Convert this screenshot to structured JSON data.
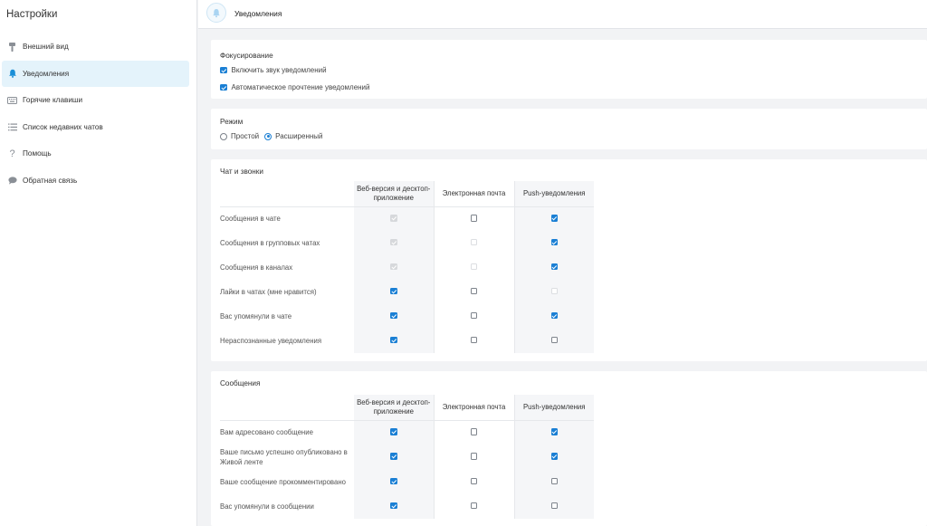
{
  "sidebar": {
    "title": "Настройки",
    "items": [
      {
        "label": "Внешний вид",
        "icon": "brush-icon",
        "active": false
      },
      {
        "label": "Уведомления",
        "icon": "bell-icon",
        "active": true
      },
      {
        "label": "Горячие клавиши",
        "icon": "keyboard-icon",
        "active": false
      },
      {
        "label": "Список недавних чатов",
        "icon": "list-icon",
        "active": false
      },
      {
        "label": "Помощь",
        "icon": "question-icon",
        "active": false
      },
      {
        "label": "Обратная связь",
        "icon": "chat-bubble-icon",
        "active": false
      }
    ]
  },
  "header": {
    "title": "Уведомления",
    "icon": "bell-icon"
  },
  "focus": {
    "title": "Фокусирование",
    "options": [
      {
        "label": "Включить звук уведомлений",
        "checked": true
      },
      {
        "label": "Автоматическое прочтение уведомлений",
        "checked": true
      }
    ]
  },
  "mode": {
    "title": "Режим",
    "options": [
      {
        "label": "Простой",
        "selected": false
      },
      {
        "label": "Расширенный",
        "selected": true
      }
    ]
  },
  "columns": {
    "web": "Веб-версия и десктоп-приложение",
    "email": "Электронная почта",
    "push": "Push-уведомления"
  },
  "chat": {
    "title": "Чат и звонки",
    "rows": [
      {
        "label": "Сообщения в чате",
        "web": "dis-on",
        "email": "off",
        "push": "on"
      },
      {
        "label": "Сообщения в групповых чатах",
        "web": "dis-on",
        "email": "dis-off",
        "push": "on"
      },
      {
        "label": "Сообщения в каналах",
        "web": "dis-on",
        "email": "dis-off",
        "push": "on"
      },
      {
        "label": "Лайки в чатах (мне нравится)",
        "web": "on",
        "email": "off",
        "push": "dis-off"
      },
      {
        "label": "Вас упомянули в чате",
        "web": "on",
        "email": "off",
        "push": "on"
      },
      {
        "label": "Нераспознанные уведомления",
        "web": "on",
        "email": "off",
        "push": "off"
      }
    ]
  },
  "messages": {
    "title": "Сообщения",
    "rows": [
      {
        "label": "Вам адресовано сообщение",
        "web": "on",
        "email": "off",
        "push": "on"
      },
      {
        "label": "Ваше письмо успешно опубликовано в Живой ленте",
        "web": "on",
        "email": "off",
        "push": "on"
      },
      {
        "label": "Ваше сообщение прокомментировано",
        "web": "on",
        "email": "off",
        "push": "off"
      },
      {
        "label": "Вас упомянули в сообщении",
        "web": "on",
        "email": "off",
        "push": "off"
      }
    ]
  },
  "colors": {
    "accent": "#1a7fd4",
    "active_bg": "#e4f3fb",
    "page_bg": "#f2f3f5"
  }
}
